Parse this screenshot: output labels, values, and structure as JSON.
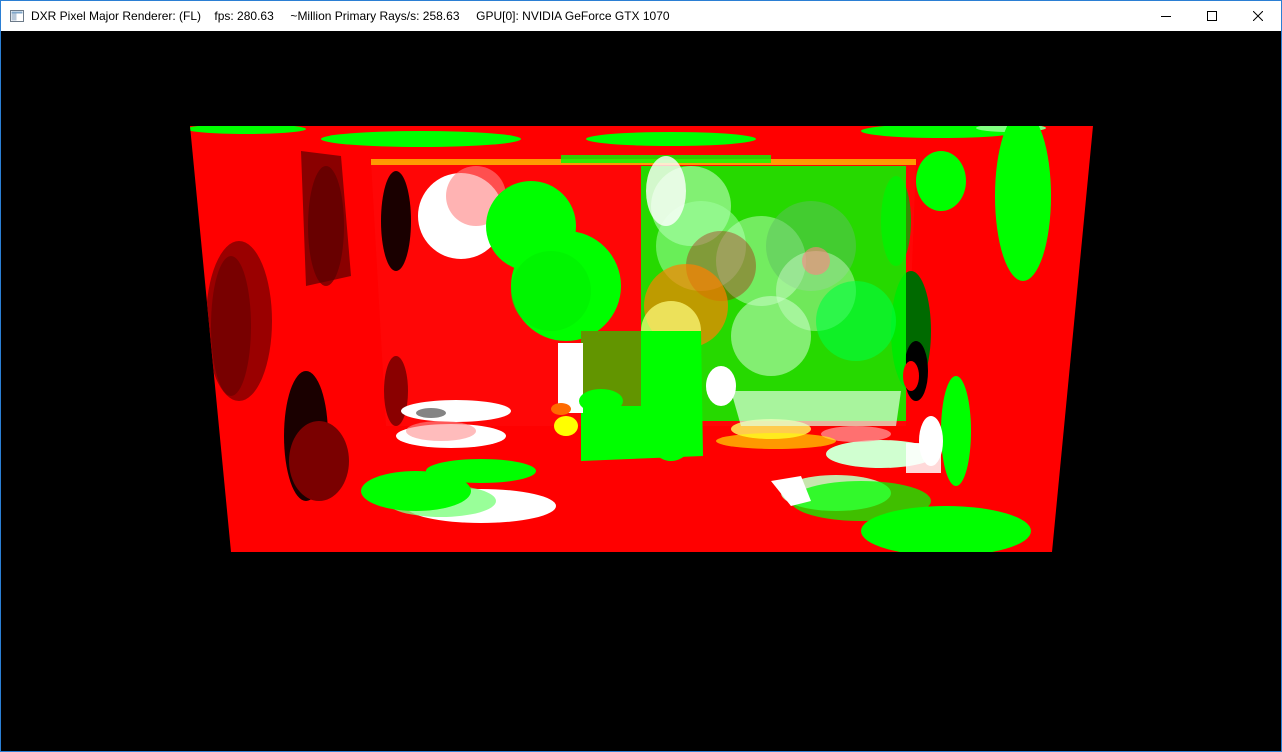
{
  "window": {
    "title": "DXR Pixel Major Renderer: (FL)    fps: 280.63     ~Million Primary Rays/s: 258.63     GPU[0]: NVIDIA GeForce GTX 1070",
    "app_icon": "window-app-icon",
    "controls": {
      "minimize_icon": "minimize-icon",
      "maximize_icon": "maximize-icon",
      "close_icon": "close-icon"
    }
  },
  "scene": {
    "description_colors": {
      "background": "#000000",
      "wall": "#ff0000",
      "green": "#00ff00",
      "white": "#ffffff",
      "yellow": "#ffff00",
      "dark_red": "#7a0000"
    }
  }
}
